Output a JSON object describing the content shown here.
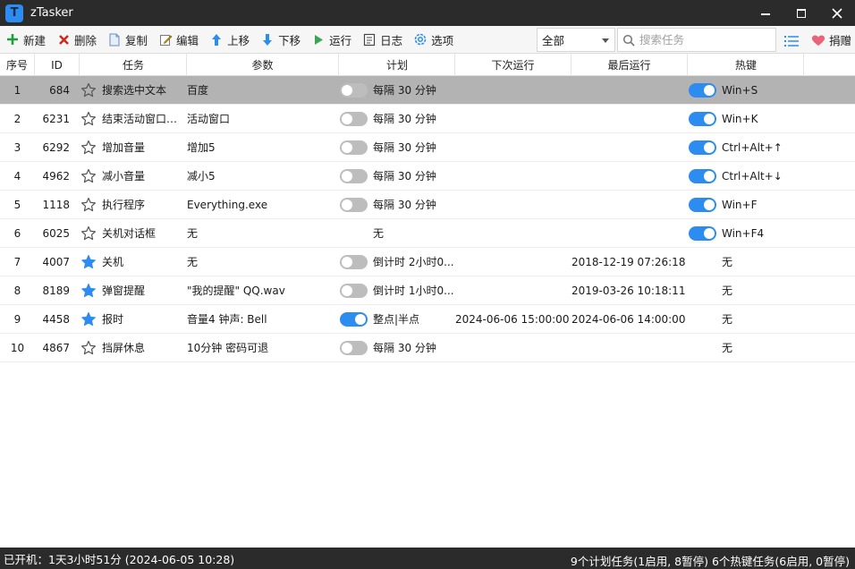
{
  "window": {
    "title": "zTasker"
  },
  "toolbar": {
    "new_label": "新建",
    "delete_label": "删除",
    "copy_label": "复制",
    "edit_label": "编辑",
    "up_label": "上移",
    "down_label": "下移",
    "run_label": "运行",
    "log_label": "日志",
    "options_label": "选项",
    "filter_value": "全部",
    "search_placeholder": "搜索任务",
    "donate_label": "捐赠"
  },
  "columns": {
    "idx": "序号",
    "id": "ID",
    "task": "任务",
    "param": "参数",
    "schedule": "计划",
    "next_run": "下次运行",
    "last_run": "最后运行",
    "hotkey": "热键"
  },
  "rows": [
    {
      "idx": "1",
      "id": "684",
      "starred": false,
      "task": "搜索选中文本",
      "param": "百度",
      "sched_toggle": "off",
      "schedule": "每隔 30 分钟",
      "next_run": "",
      "last_run": "",
      "hot_toggle": "on",
      "hotkey": "Win+S"
    },
    {
      "idx": "2",
      "id": "6231",
      "starred": false,
      "task": "结束活动窗口及...",
      "param": "活动窗口",
      "sched_toggle": "off",
      "schedule": "每隔 30 分钟",
      "next_run": "",
      "last_run": "",
      "hot_toggle": "on",
      "hotkey": "Win+K"
    },
    {
      "idx": "3",
      "id": "6292",
      "starred": false,
      "task": "增加音量",
      "param": "增加5",
      "sched_toggle": "off",
      "schedule": "每隔 30 分钟",
      "next_run": "",
      "last_run": "",
      "hot_toggle": "on",
      "hotkey": "Ctrl+Alt+↑"
    },
    {
      "idx": "4",
      "id": "4962",
      "starred": false,
      "task": "减小音量",
      "param": "减小5",
      "sched_toggle": "off",
      "schedule": "每隔 30 分钟",
      "next_run": "",
      "last_run": "",
      "hot_toggle": "on",
      "hotkey": "Ctrl+Alt+↓"
    },
    {
      "idx": "5",
      "id": "1118",
      "starred": false,
      "task": "执行程序",
      "param": "Everything.exe",
      "sched_toggle": "off",
      "schedule": "每隔 30 分钟",
      "next_run": "",
      "last_run": "",
      "hot_toggle": "on",
      "hotkey": "Win+F"
    },
    {
      "idx": "6",
      "id": "6025",
      "starred": false,
      "task": "关机对话框",
      "param": "无",
      "sched_toggle": "none",
      "schedule": "无",
      "next_run": "",
      "last_run": "",
      "hot_toggle": "on",
      "hotkey": "Win+F4"
    },
    {
      "idx": "7",
      "id": "4007",
      "starred": true,
      "task": "关机",
      "param": "无",
      "sched_toggle": "off",
      "schedule": "倒计时 2小时0...",
      "next_run": "",
      "last_run": "2018-12-19 07:26:18",
      "hot_toggle": "none",
      "hotkey": "无"
    },
    {
      "idx": "8",
      "id": "8189",
      "starred": true,
      "task": "弹窗提醒",
      "param": "\"我的提醒\" QQ.wav",
      "sched_toggle": "off",
      "schedule": "倒计时 1小时0...",
      "next_run": "",
      "last_run": "2019-03-26 10:18:11",
      "hot_toggle": "none",
      "hotkey": "无"
    },
    {
      "idx": "9",
      "id": "4458",
      "starred": true,
      "task": "报时",
      "param": "音量4 钟声: Bell",
      "sched_toggle": "on",
      "schedule": "整点|半点",
      "next_run": "2024-06-06 15:00:00",
      "last_run": "2024-06-06 14:00:00",
      "hot_toggle": "none",
      "hotkey": "无"
    },
    {
      "idx": "10",
      "id": "4867",
      "starred": false,
      "task": "挡屏休息",
      "param": "10分钟 密码可退",
      "sched_toggle": "off",
      "schedule": "每隔 30 分钟",
      "next_run": "",
      "last_run": "",
      "hot_toggle": "none",
      "hotkey": "无"
    }
  ],
  "selected_row": 0,
  "statusbar": {
    "uptime": "已开机：1天3小时51分 (2024-06-05 10:28)",
    "summary": "9个计划任务(1启用, 8暂停)  6个热键任务(6启用, 0暂停)"
  },
  "colors": {
    "accent": "#2d8cf0",
    "titlebar": "#2b2b2b",
    "selected_row": "#b3b3b3"
  }
}
